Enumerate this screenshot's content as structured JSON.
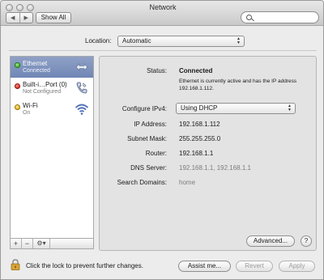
{
  "window": {
    "title": "Network"
  },
  "toolbar": {
    "back_glyph": "◀",
    "forward_glyph": "▶",
    "show_all_label": "Show All"
  },
  "location": {
    "label": "Location:",
    "value": "Automatic"
  },
  "services": [
    {
      "name": "Ethernet",
      "status": "Connected",
      "dot_color": "green",
      "icon": "ethernet-arrows-icon",
      "selected": true
    },
    {
      "name": "Built-i…Port (0)",
      "status": "Not Configured",
      "dot_color": "red",
      "icon": "phone-modem-icon",
      "selected": false
    },
    {
      "name": "Wi-Fi",
      "status": "On",
      "dot_color": "yellow",
      "icon": "wifi-icon",
      "selected": false
    }
  ],
  "sidebar_controls": {
    "add": "+",
    "remove": "−",
    "gear": "⚙▾"
  },
  "detail": {
    "status_label": "Status:",
    "status_value": "Connected",
    "status_description": "Ethernet is currently active and has the IP address 192.168.1.112.",
    "configure_label": "Configure IPv4:",
    "configure_value": "Using DHCP",
    "ip_label": "IP Address:",
    "ip_value": "192.168.1.112",
    "subnet_label": "Subnet Mask:",
    "subnet_value": "255.255.255.0",
    "router_label": "Router:",
    "router_value": "192.168.1.1",
    "dns_label": "DNS Server:",
    "dns_value": "192.168.1.1, 192.168.1.1",
    "search_domains_label": "Search Domains:",
    "search_domains_value": "home",
    "advanced_label": "Advanced...",
    "help_label": "?"
  },
  "footer": {
    "lock_text": "Click the lock to prevent further changes.",
    "assist_label": "Assist me...",
    "revert_label": "Revert",
    "apply_label": "Apply"
  }
}
